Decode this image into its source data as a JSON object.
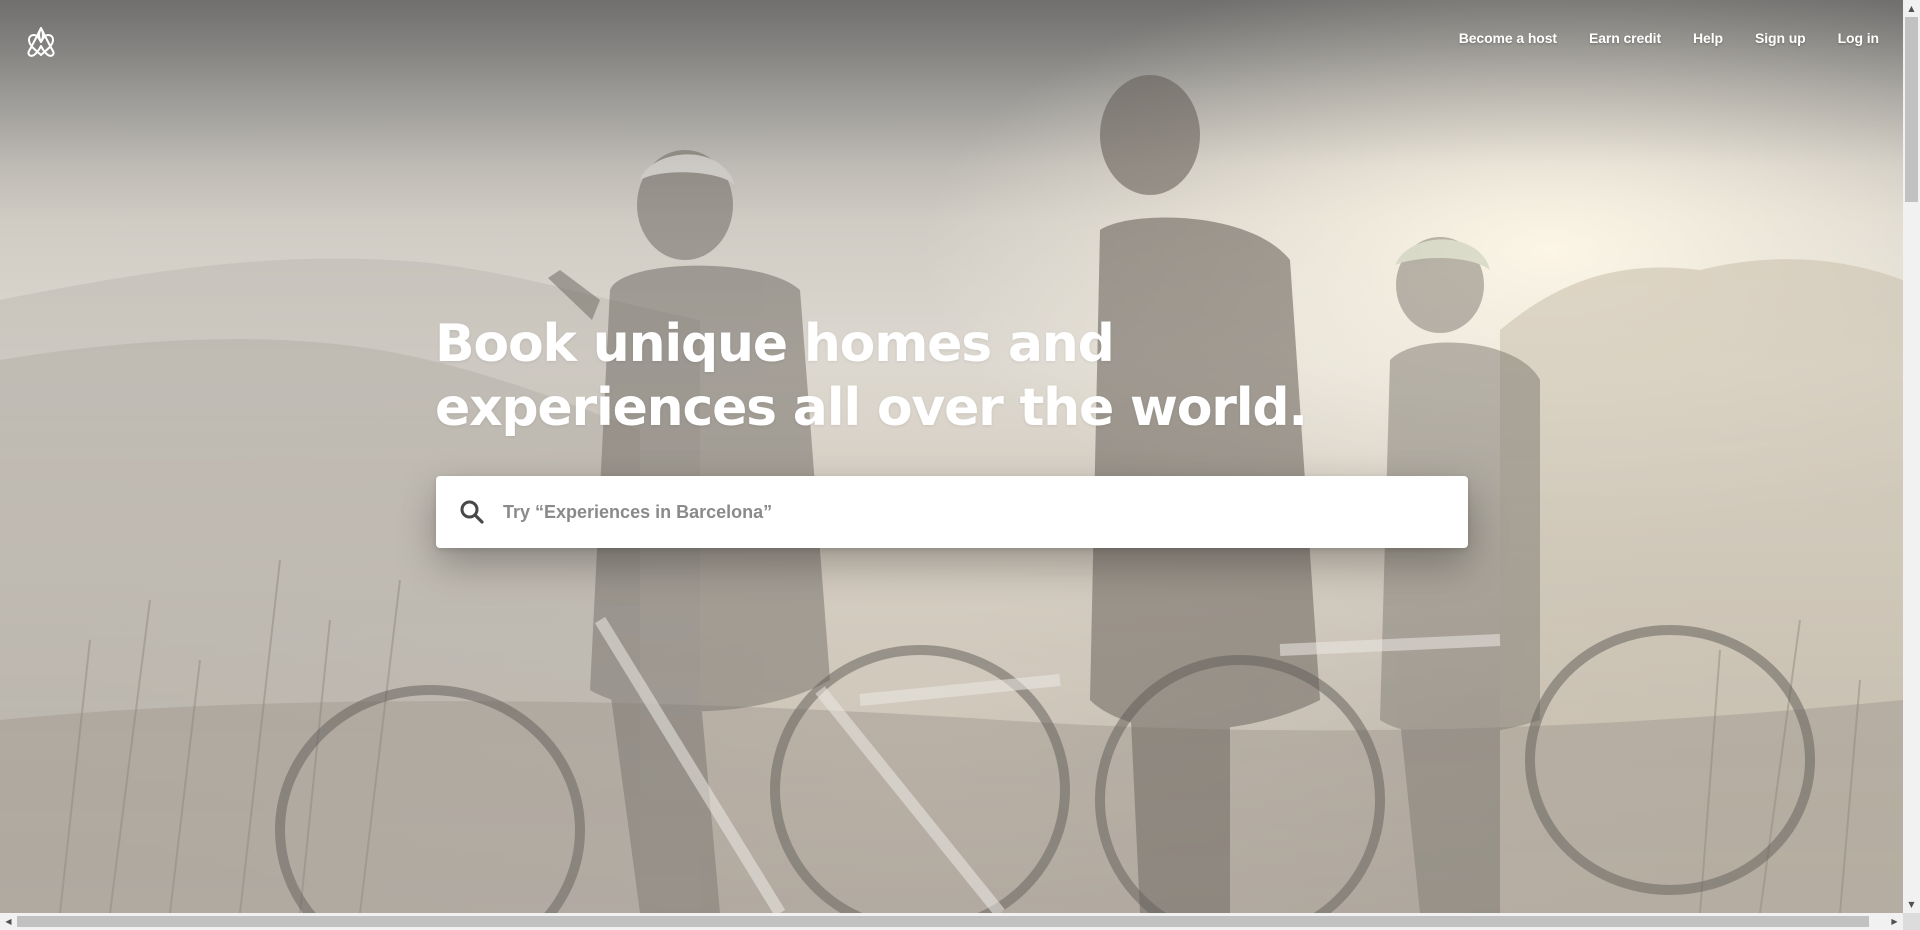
{
  "header": {
    "logo_icon": "airbnb-belo-icon",
    "nav": [
      {
        "label": "Become a host"
      },
      {
        "label": "Earn credit"
      },
      {
        "label": "Help"
      },
      {
        "label": "Sign up"
      },
      {
        "label": "Log in"
      }
    ]
  },
  "hero": {
    "headline_line1": "Book unique homes and",
    "headline_line2": "experiences all over the world.",
    "background_image": "cyclists-with-mountain-bikes-at-misty-sunrise"
  },
  "search": {
    "icon": "search-icon",
    "placeholder": "Try “Experiences in Barcelona”",
    "value": ""
  },
  "colors": {
    "text_light": "#ffffff",
    "search_text": "#484848",
    "placeholder": "#8a8a8a"
  },
  "scrollbars": {
    "vertical_arrow_up": "▲",
    "vertical_arrow_down": "▼",
    "horizontal_arrow_left": "◀",
    "horizontal_arrow_right": "▶"
  }
}
